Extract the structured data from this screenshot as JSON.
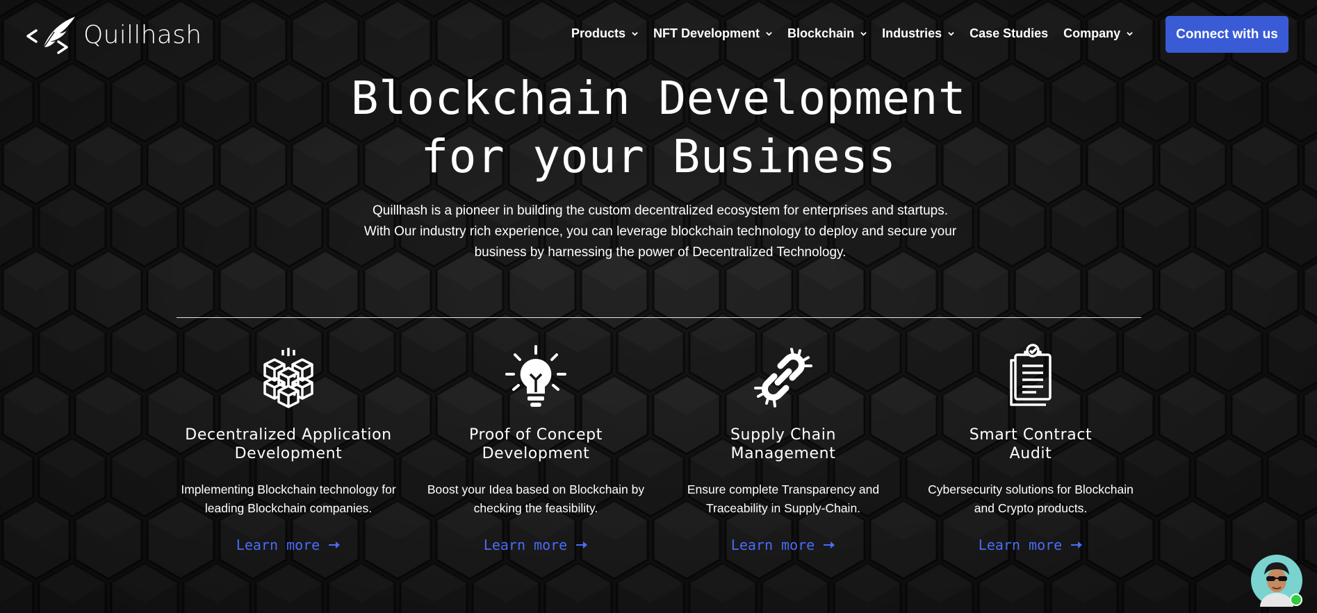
{
  "brand": {
    "name": "Quillhash",
    "logo_icon": "quill-code-logo-icon"
  },
  "nav": {
    "items": [
      {
        "label": "Products",
        "dropdown": true
      },
      {
        "label": "NFT Development",
        "dropdown": true
      },
      {
        "label": "Blockchain",
        "dropdown": true
      },
      {
        "label": "Industries",
        "dropdown": true
      },
      {
        "label": "Case Studies",
        "dropdown": false
      },
      {
        "label": "Company",
        "dropdown": true
      }
    ],
    "cta_label": "Connect with us"
  },
  "hero": {
    "title_line1": "Blockchain Development",
    "title_line2": "for your Business",
    "desc_line1": "Quillhash is a pioneer in building the custom decentralized ecosystem for enterprises and startups.",
    "desc_line2": "With Our industry rich experience, you can leverage blockchain technology to deploy and secure your",
    "desc_line3": "business by harnessing the power of Decentralized Technology."
  },
  "features": [
    {
      "icon": "cubes-icon",
      "title_line1": "Decentralized Application",
      "title_line2": "Development",
      "desc_line1": "Implementing Blockchain technology for",
      "desc_line2": "leading Blockchain companies.",
      "link_label": "Learn more"
    },
    {
      "icon": "lightbulb-icon",
      "title_line1": "Proof of Concept",
      "title_line2": "Development",
      "desc_line1": "Boost your Idea based on Blockchain by",
      "desc_line2": "checking the feasibility.",
      "link_label": "Learn more"
    },
    {
      "icon": "chain-link-icon",
      "title_line1": "Supply Chain",
      "title_line2": "Management",
      "desc_line1": "Ensure complete Transparency and",
      "desc_line2": "Traceability in Supply-Chain.",
      "link_label": "Learn more"
    },
    {
      "icon": "clipboard-check-icon",
      "title_line1": "Smart Contract",
      "title_line2": "Audit",
      "desc_line1": "Cybersecurity solutions for Blockchain",
      "desc_line2": "and Crypto products.",
      "link_label": "Learn more"
    }
  ],
  "chat": {
    "icon": "chat-avatar-icon",
    "status_color": "#2ecc40"
  },
  "colors": {
    "accent": "#3a5bd6",
    "link": "#4a6cf7",
    "background": "#161616"
  }
}
